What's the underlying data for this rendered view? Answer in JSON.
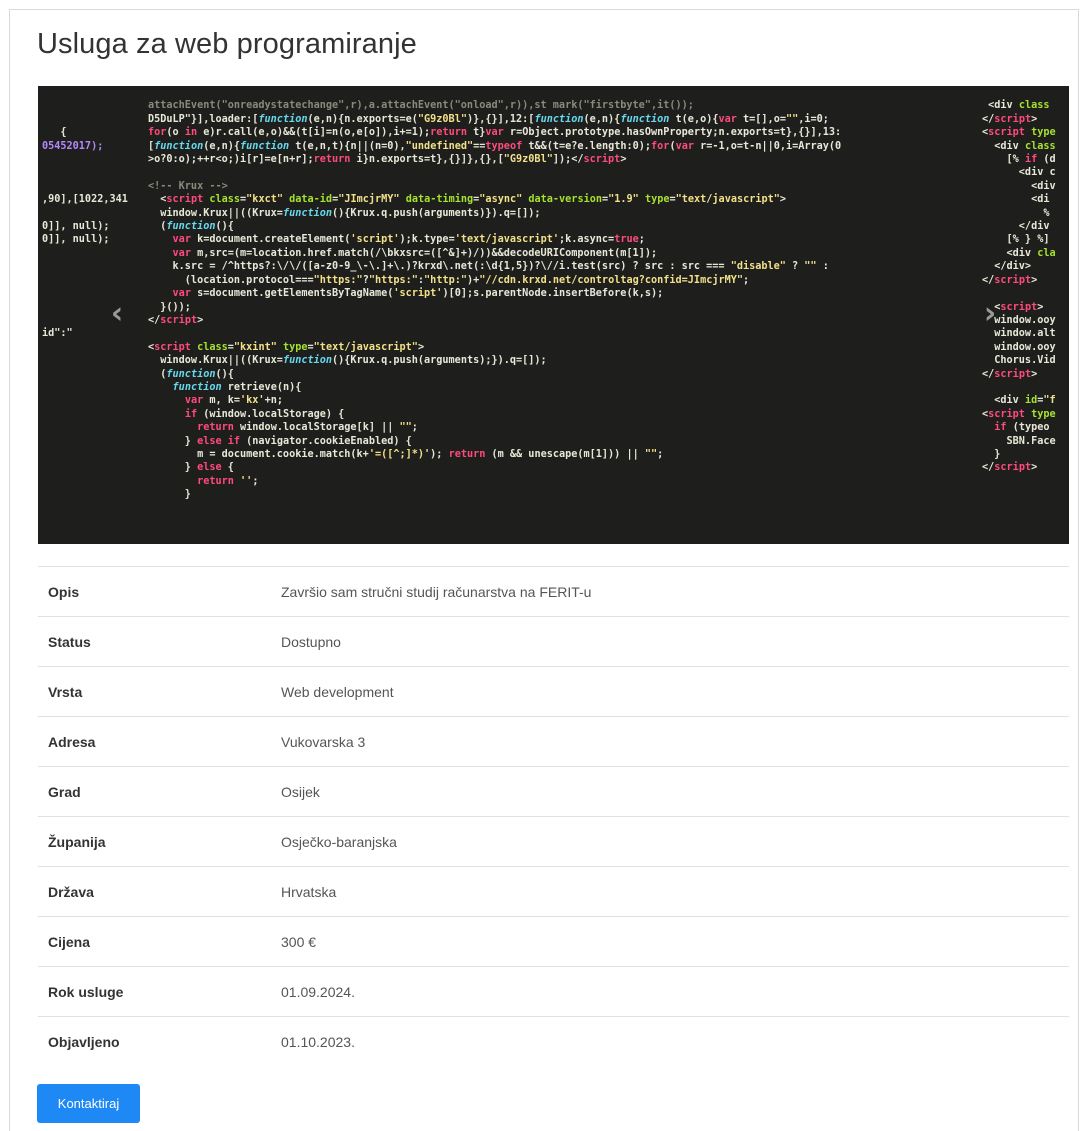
{
  "page": {
    "title": "Usluga za web programiranje"
  },
  "image": {
    "description": "",
    "prev_label": "‹",
    "next_label": "›"
  },
  "details": [
    {
      "label": "Opis",
      "value": "Završio sam stručni studij računarstva na FERIT-u"
    },
    {
      "label": "Status",
      "value": "Dostupno"
    },
    {
      "label": "Vrsta",
      "value": "Web development"
    },
    {
      "label": "Adresa",
      "value": "Vukovarska 3"
    },
    {
      "label": "Grad",
      "value": "Osijek"
    },
    {
      "label": "Županija",
      "value": "Osječko-baranjska"
    },
    {
      "label": "Država",
      "value": "Hrvatska"
    },
    {
      "label": "Cijena",
      "value": "300 €"
    },
    {
      "label": "Rok usluge",
      "value": "01.09.2024."
    },
    {
      "label": "Objavljeno",
      "value": "01.10.2023."
    }
  ],
  "actions": {
    "contact_label": "Kontaktiraj"
  }
}
